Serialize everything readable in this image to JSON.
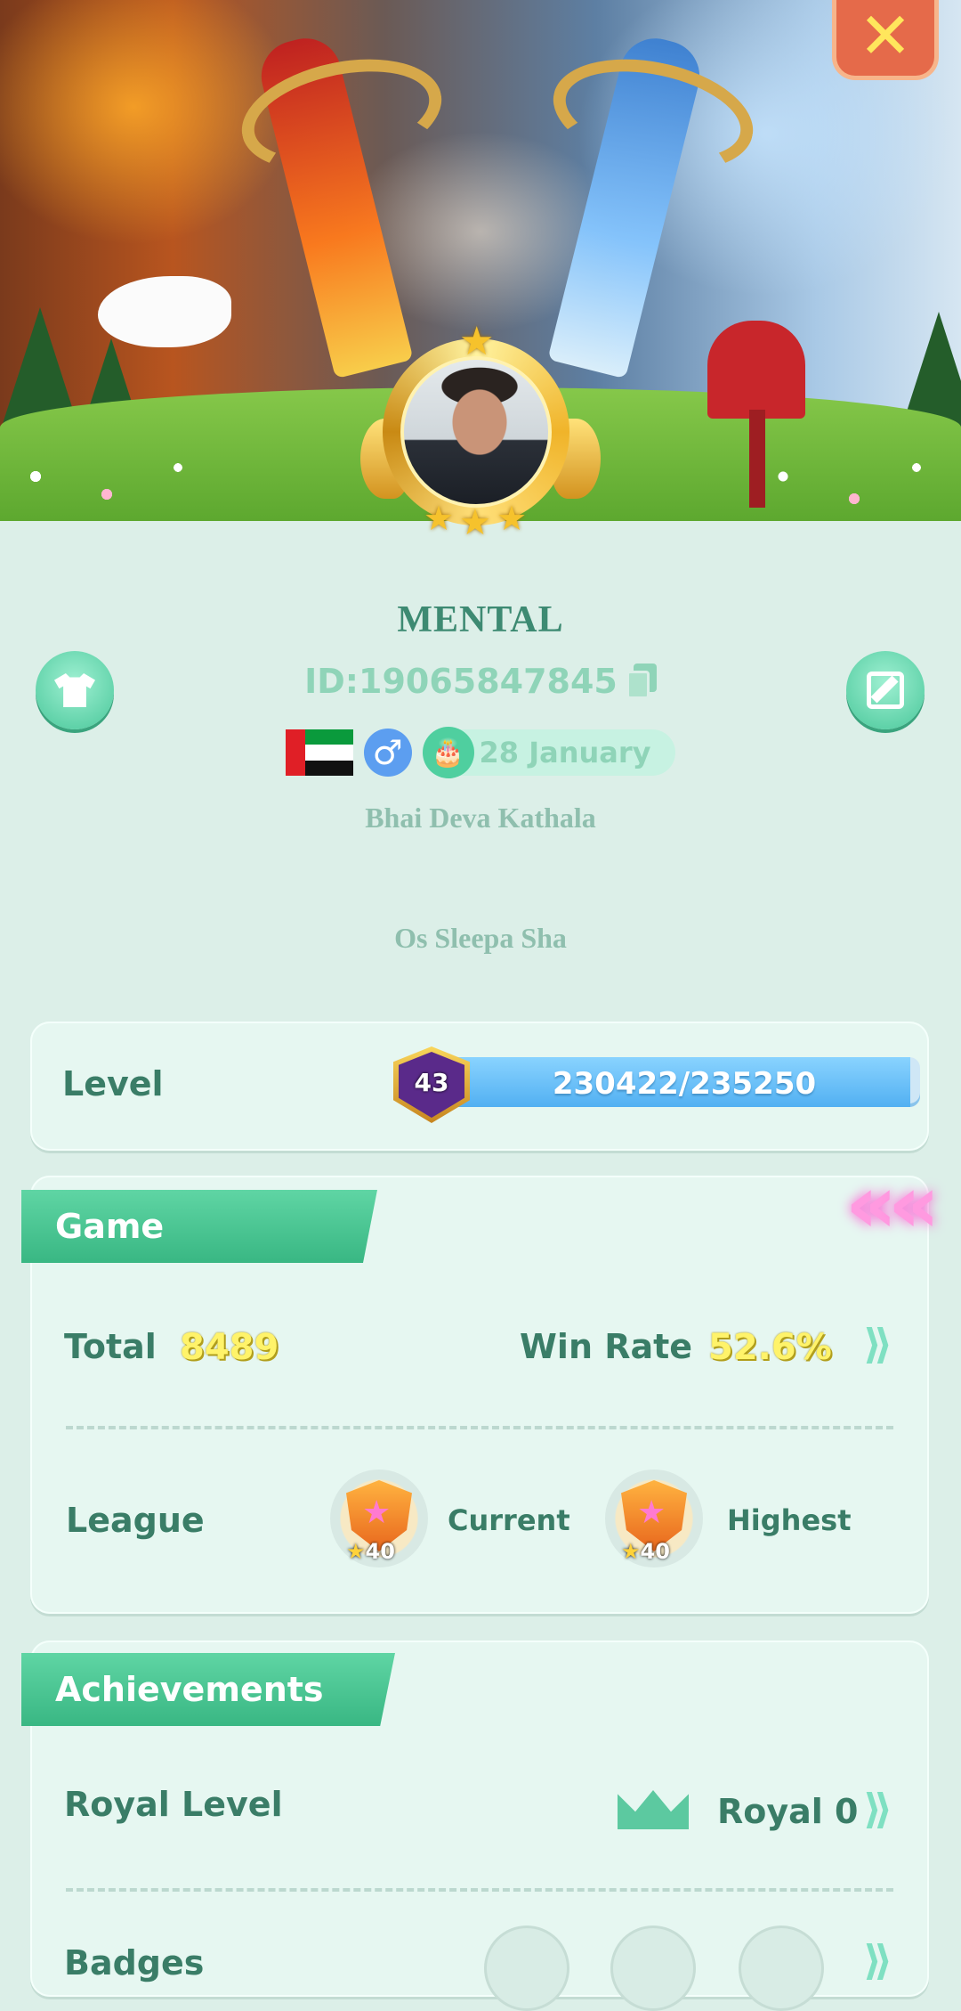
{
  "profile": {
    "name": "MENTAL",
    "id_text": "ID:19065847845",
    "gender_symbol": "♂",
    "birthday": "28 January",
    "signature_line1": "Bhai Deva Kathala",
    "signature_line2": "Os Sleepa Sha"
  },
  "header": {
    "close_symbol": "✕"
  },
  "level": {
    "label": "Level",
    "badge": "43",
    "progress_text": "230422/235250",
    "current": 230422,
    "max": 235250
  },
  "game": {
    "title": "Game",
    "total_label": "Total",
    "total_value": "8489",
    "winrate_label": "Win Rate",
    "winrate_value": "52.6%",
    "league_label": "League",
    "current_label": "Current",
    "highest_label": "Highest",
    "current_count": "40",
    "highest_count": "40"
  },
  "achievements": {
    "title": "Achievements",
    "royal_label": "Royal Level",
    "royal_value": "Royal 0",
    "badges_label": "Badges"
  },
  "colors": {
    "accent": "#49c79a",
    "background": "#dcefe8",
    "text_dark": "#3a7d67",
    "value_yellow": "#fff36a"
  }
}
